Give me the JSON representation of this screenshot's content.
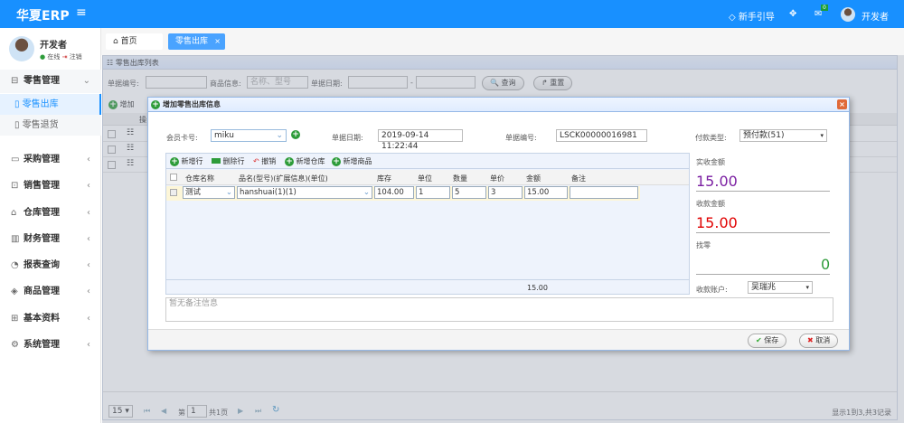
{
  "header": {
    "logo": "华夏ERP",
    "guide": "新手引导",
    "mail_badge": "0",
    "user": "开发者"
  },
  "sidebar": {
    "user": "开发者",
    "status_online": "在线",
    "logout": "注销",
    "menu": [
      {
        "label": "零售管理",
        "icon": "gift-icon",
        "expanded": true
      },
      {
        "label": "采购管理",
        "icon": "monitor-icon"
      },
      {
        "label": "销售管理",
        "icon": "briefcase-icon"
      },
      {
        "label": "仓库管理",
        "icon": "warehouse-icon"
      },
      {
        "label": "财务管理",
        "icon": "book-icon"
      },
      {
        "label": "报表查询",
        "icon": "chart-pie-icon"
      },
      {
        "label": "商品管理",
        "icon": "layers-icon"
      },
      {
        "label": "基本资料",
        "icon": "grid-icon"
      },
      {
        "label": "系统管理",
        "icon": "gear-icon"
      }
    ],
    "submenu": [
      {
        "label": "零售出库",
        "active": true
      },
      {
        "label": "零售退货"
      }
    ]
  },
  "tabs": [
    {
      "label": "首页"
    },
    {
      "label": "零售出库",
      "active": true
    }
  ],
  "panel": {
    "title": "零售出库列表",
    "search": {
      "bill_no_label": "单据编号:",
      "goods_label": "商品信息:",
      "goods_placeholder": "名称、型号",
      "date_label": "单据日期:",
      "date_sep": "-",
      "query": "查询",
      "reset": "重置"
    },
    "toolbar": {
      "add": "增加"
    },
    "col_op": "操",
    "pagination": {
      "page_size": "15",
      "page_prefix": "第",
      "page": "1",
      "page_total": "共1页",
      "summary": "显示1到3,共3记录"
    }
  },
  "modal": {
    "title": "增加零售出库信息",
    "member_label": "会员卡号:",
    "member": "miku",
    "date_label": "单据日期:",
    "date": "2019-09-14 11:22:44",
    "bill_label": "单据编号:",
    "bill_no": "LSCK00000016981",
    "pay_label": "付款类型:",
    "pay_type": "预付款(51)",
    "grid_toolbar": [
      "新增行",
      "删除行",
      "撤销",
      "新增仓库",
      "新增商品"
    ],
    "columns": [
      "仓库名称",
      "品名(型号)(扩展信息)(单位)",
      "库存",
      "单位",
      "数量",
      "单价",
      "金额",
      "备注"
    ],
    "row": {
      "warehouse": "测试",
      "product": "hanshuai(1)(1)",
      "stock": "104.00",
      "unit": "1",
      "qty": "5",
      "price": "3",
      "amount": "15.00",
      "remark": ""
    },
    "footer_total": "15.00",
    "actual_label": "实收金额",
    "actual": "15.00",
    "received_label": "收款金额",
    "received": "15.00",
    "change_label": "找零",
    "change": "0",
    "account_label": "收款账户:",
    "account": "吴瑞兆",
    "remark_placeholder": "暂无备注信息",
    "save": "保存",
    "cancel": "取消"
  },
  "colors": {
    "brand": "#1890ff",
    "actual": "#7b1fa2",
    "received": "#e00000",
    "change": "#2e9c3a"
  }
}
